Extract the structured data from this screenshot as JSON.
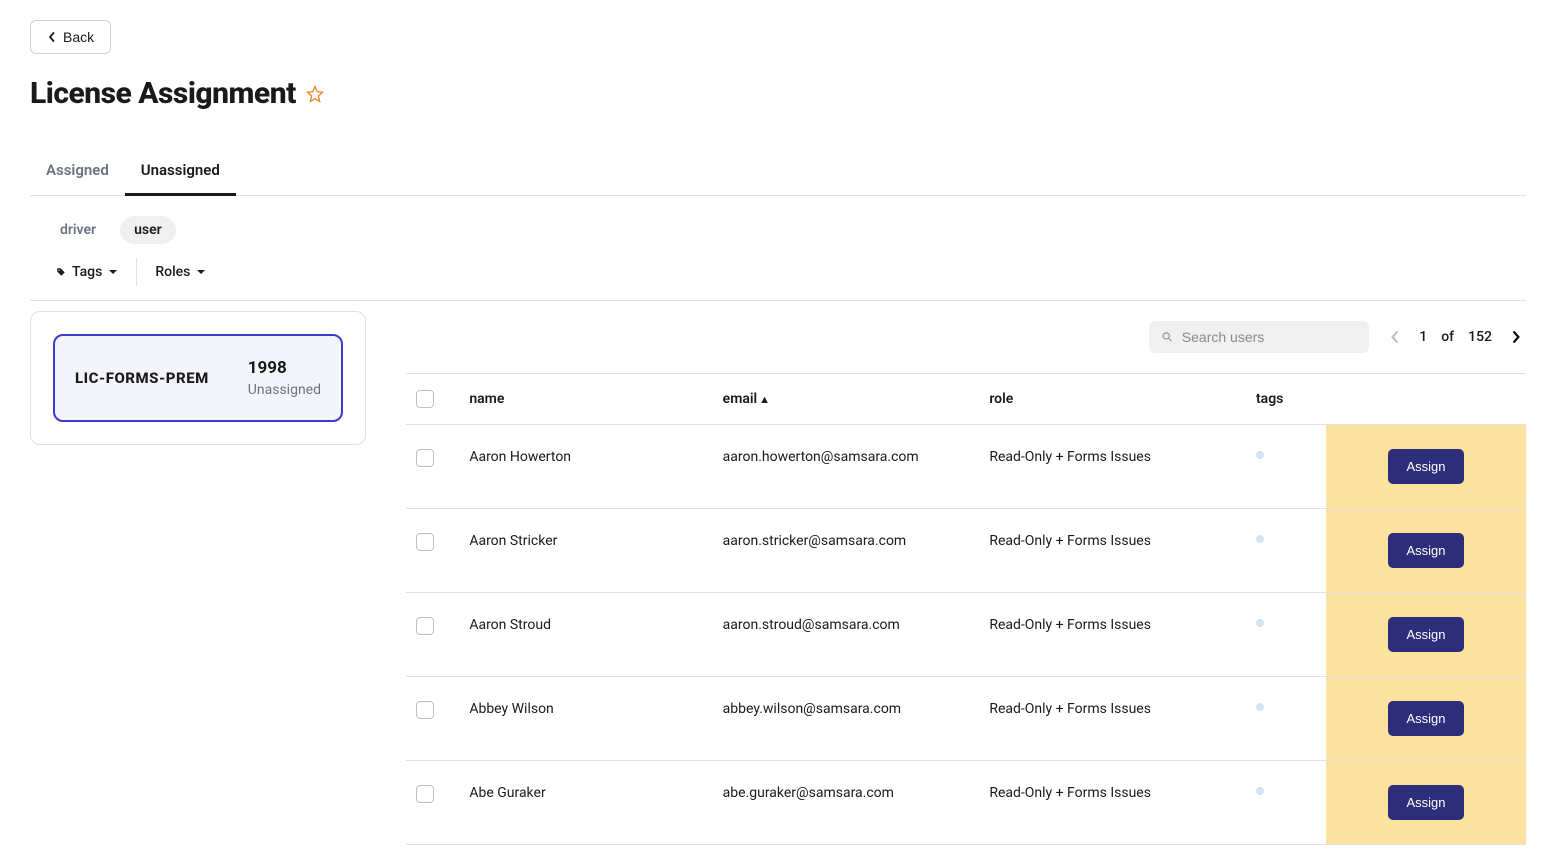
{
  "back_label": "Back",
  "page_title": "License Assignment",
  "tabs": {
    "assigned": "Assigned",
    "unassigned": "Unassigned"
  },
  "type_filters": {
    "driver": "driver",
    "user": "user"
  },
  "filter_dropdowns": {
    "tags": "Tags",
    "roles": "Roles"
  },
  "license_card": {
    "name": "LIC-FORMS-PREM",
    "count": "1998",
    "status": "Unassigned"
  },
  "search": {
    "placeholder": "Search users"
  },
  "pagination": {
    "page": "1",
    "of": "of",
    "total": "152"
  },
  "columns": {
    "name": "name",
    "email": "email",
    "sort_indicator": "▲",
    "role": "role",
    "tags": "tags"
  },
  "assign_label": "Assign",
  "rows": [
    {
      "name": "Aaron Howerton",
      "email": "aaron.howerton@samsara.com",
      "role": "Read-Only + Forms Issues"
    },
    {
      "name": "Aaron Stricker",
      "email": "aaron.stricker@samsara.com",
      "role": "Read-Only + Forms Issues"
    },
    {
      "name": "Aaron Stroud",
      "email": "aaron.stroud@samsara.com",
      "role": "Read-Only + Forms Issues"
    },
    {
      "name": "Abbey Wilson",
      "email": "abbey.wilson@samsara.com",
      "role": "Read-Only + Forms Issues"
    },
    {
      "name": "Abe Guraker",
      "email": "abe.guraker@samsara.com",
      "role": "Read-Only + Forms Issues"
    }
  ]
}
